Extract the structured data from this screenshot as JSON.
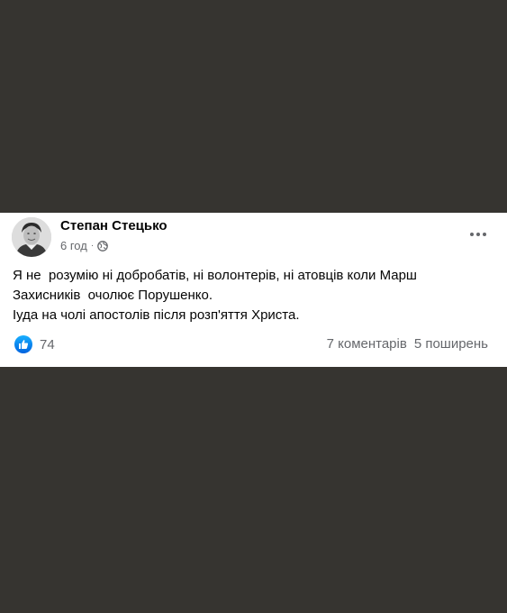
{
  "post": {
    "author": "Степан Стецько",
    "time": "6 год",
    "separator": "·",
    "privacy_icon": "globe-icon",
    "menu_icon": "more-options-icon",
    "text_lines": [
      "Я не  розумію ні добробатів, ні волонтерів, ні атовців коли Марш",
      "Захисників  очолює Порушенко.",
      "Іуда на чолі апостолів після розп'яття Христа."
    ],
    "reactions": {
      "icon": "like-icon",
      "count": "74"
    },
    "comments": "7 коментарів",
    "shares": "5 поширень"
  },
  "colors": {
    "page_background": "#363430",
    "card_background": "#ffffff",
    "text_primary": "#050505",
    "text_secondary": "#65676b",
    "like_blue": "#1877f2"
  }
}
